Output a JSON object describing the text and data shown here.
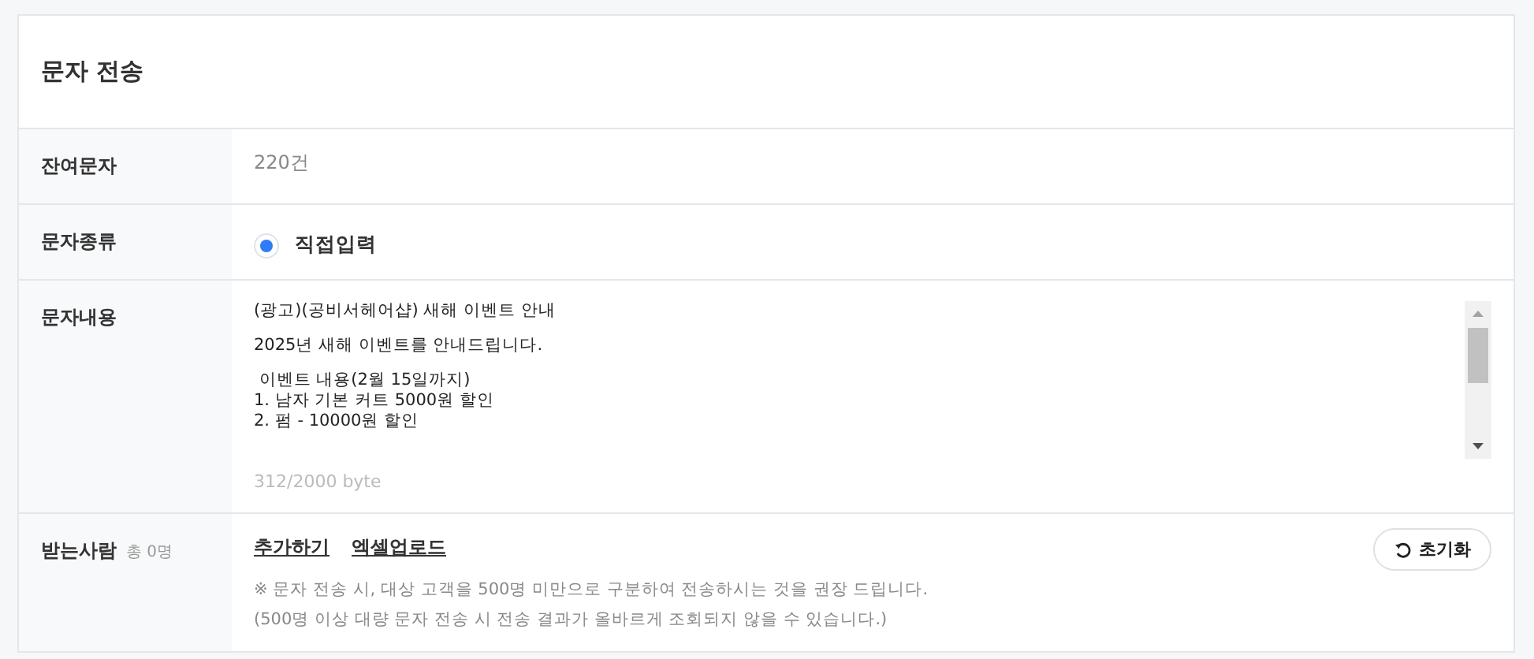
{
  "title": "문자 전송",
  "rows": [
    {
      "kind": "text",
      "label": "잔여문자",
      "value": "220건"
    },
    {
      "kind": "radio",
      "label": "문자종류",
      "options": [
        {
          "label": "직접입력",
          "selected": true
        }
      ]
    },
    {
      "kind": "message",
      "label": "문자내용",
      "paragraphs": [
        [
          "(광고)(공비서헤어샵) 새해 이벤트 안내"
        ],
        [
          "2025년 새해 이벤트를 안내드립니다."
        ],
        [
          " 이벤트 내용(2월 15일까지)",
          "1. 남자 기본 커트 5000원 할인",
          "2. 펌 - 10000원 할인"
        ]
      ],
      "counter": "312/2000 byte"
    },
    {
      "kind": "recipients",
      "label": "받는사람",
      "count": "총 0명",
      "links": [
        "추가하기",
        "엑셀업로드"
      ],
      "reset": "초기화",
      "notes": [
        "※ 문자 전송 시, 대상 고객을 500명 미만으로 구분하여 전송하시는 것을 권장 드립니다.",
        "(500명 이상 대량 문자 전송 시 전송 결과가 올바르게 조회되지 않을 수 있습니다.)"
      ]
    }
  ]
}
